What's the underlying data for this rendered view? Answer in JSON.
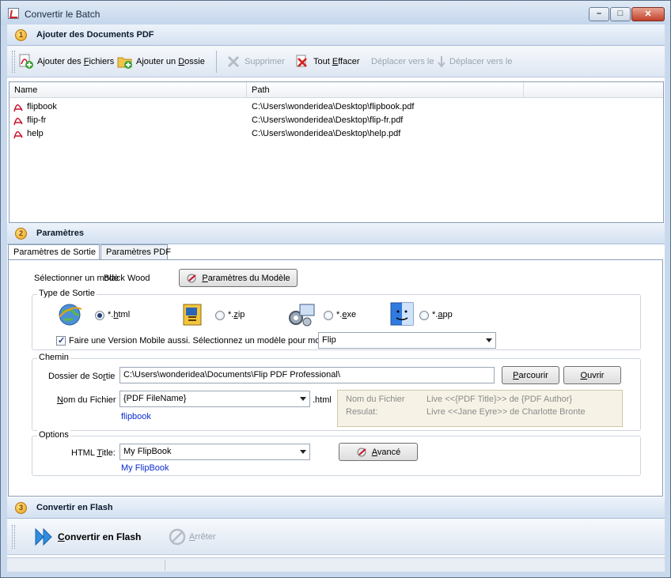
{
  "window": {
    "title": "Convertir le Batch",
    "controls": {
      "minimize": "–",
      "maximize": "□",
      "close": "✕"
    }
  },
  "sections": {
    "add": {
      "number": "1",
      "title": "Ajouter des Documents PDF"
    },
    "params": {
      "number": "2",
      "title": "Paramètres"
    },
    "convert": {
      "number": "3",
      "title": "Convertir en Flash"
    }
  },
  "toolbar": {
    "add_files_pre": "Ajouter des ",
    "add_files_key": "F",
    "add_files_post": "ichiers",
    "add_folder_pre": "Ajouter un ",
    "add_folder_key": "D",
    "add_folder_post": "ossie",
    "delete": "Supprimer",
    "clear_pre": "Tout ",
    "clear_key": "E",
    "clear_post": "ffacer",
    "move_up": "Déplacer vers le",
    "move_down": "Déplacer vers le"
  },
  "file_list": {
    "columns": [
      "Name",
      "Path"
    ],
    "rows": [
      {
        "name": "flipbook",
        "path": "C:\\Users\\wonderidea\\Desktop\\flipbook.pdf"
      },
      {
        "name": "flip-fr",
        "path": "C:\\Users\\wonderidea\\Desktop\\flip-fr.pdf"
      },
      {
        "name": "help",
        "path": "C:\\Users\\wonderidea\\Desktop\\help.pdf"
      }
    ]
  },
  "tabs": [
    "Paramètres de Sortie",
    "Paramètres PDF"
  ],
  "template": {
    "label_a": "Sélectionner un modè",
    "label_b": "Black Wood",
    "button_pre": "",
    "button_key": "P",
    "button_post": "aramètres du Modèle"
  },
  "output_type": {
    "title": "Type de Sortie",
    "options": [
      {
        "pre": "*.",
        "key": "h",
        "post": "tml",
        "selected": true
      },
      {
        "pre": "*.",
        "key": "z",
        "post": "ip",
        "selected": false
      },
      {
        "pre": "*.",
        "key": "e",
        "post": "xe",
        "selected": false
      },
      {
        "pre": "*.",
        "key": "a",
        "post": "pp",
        "selected": false
      }
    ],
    "mobile_label": "Faire une Version Mobile aussi. Sélectionnez un modèle pour mobil",
    "mobile_checked": true,
    "mobile_template": "Flip"
  },
  "path": {
    "title": "Chemin",
    "folder_label_pre": "Dossier de So",
    "folder_label_key": "r",
    "folder_label_post": "tie",
    "folder_value": "C:\\Users\\wonderidea\\Documents\\Flip PDF Professional\\",
    "browse_pre": "",
    "browse_key": "P",
    "browse_post": "arcourir",
    "open_pre": "",
    "open_key": "O",
    "open_post": "uvrir",
    "filename_label_pre": "",
    "filename_label_key": "N",
    "filename_label_post": "om du Fichier",
    "filename_value": "{PDF FileName}",
    "extension": ".html",
    "filename_preview": "flipbook",
    "info_label_1": "Nom du Fichier",
    "info_value_1": "Live <<{PDF Title}>> de {PDF Author}",
    "info_label_2": "Resulat:",
    "info_value_2": "Livre <<Jane Eyre>> de Charlotte Bronte"
  },
  "options": {
    "title": "Options",
    "html_title_label_pre": "HTML ",
    "html_title_label_key": "T",
    "html_title_label_post": "itle:",
    "html_title_value": "My FlipBook",
    "html_title_preview": "My FlipBook",
    "advanced_pre": "",
    "advanced_key": "A",
    "advanced_post": "vancé"
  },
  "convert_bar": {
    "convert_pre": "",
    "convert_key": "C",
    "convert_post": "onvertir en Flash",
    "stop_pre": "",
    "stop_key": "A",
    "stop_post": "rrêter"
  },
  "colors": {
    "accent": "#0a2bd1",
    "header_bg": "#d4e1f1",
    "pdf_red": "#c8102e"
  }
}
